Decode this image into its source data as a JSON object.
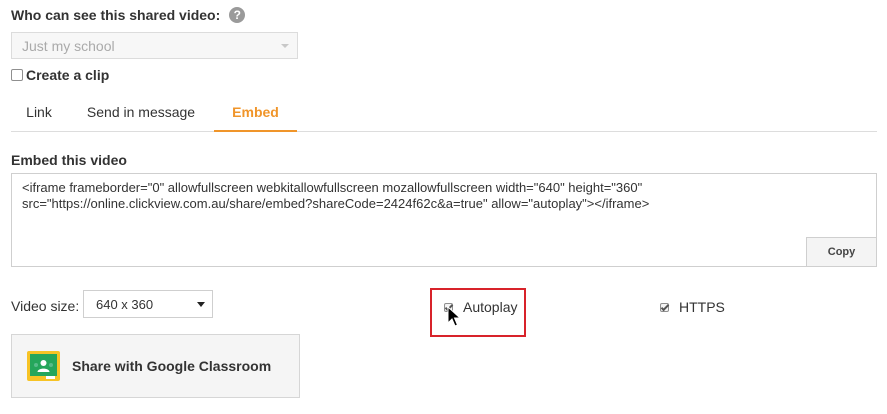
{
  "visibility": {
    "label": "Who can see this shared video:",
    "help_icon": "?",
    "selected": "Just my school"
  },
  "clip": {
    "label": "Create a clip",
    "checked": false
  },
  "tabs": [
    {
      "label": "Link",
      "active": false
    },
    {
      "label": "Send in message",
      "active": false
    },
    {
      "label": "Embed",
      "active": true
    }
  ],
  "embed": {
    "label": "Embed this video",
    "code": "<iframe frameborder=\"0\" allowfullscreen webkitallowfullscreen mozallowfullscreen width=\"640\" height=\"360\"\nsrc=\"https://online.clickview.com.au/share/embed?shareCode=2424f62c&a=true\" allow=\"autoplay\"></iframe>",
    "copy_label": "Copy"
  },
  "options": {
    "size_label": "Video size:",
    "size_selected": "640 x 360",
    "autoplay_label": "Autoplay",
    "autoplay_checked": true,
    "https_label": "HTTPS",
    "https_checked": true
  },
  "google_classroom": {
    "label": "Share with Google Classroom"
  },
  "colors": {
    "accent": "#f0952a",
    "highlight": "#d8232a",
    "classroom_green": "#25a65b",
    "classroom_yellow": "#f7c325"
  }
}
